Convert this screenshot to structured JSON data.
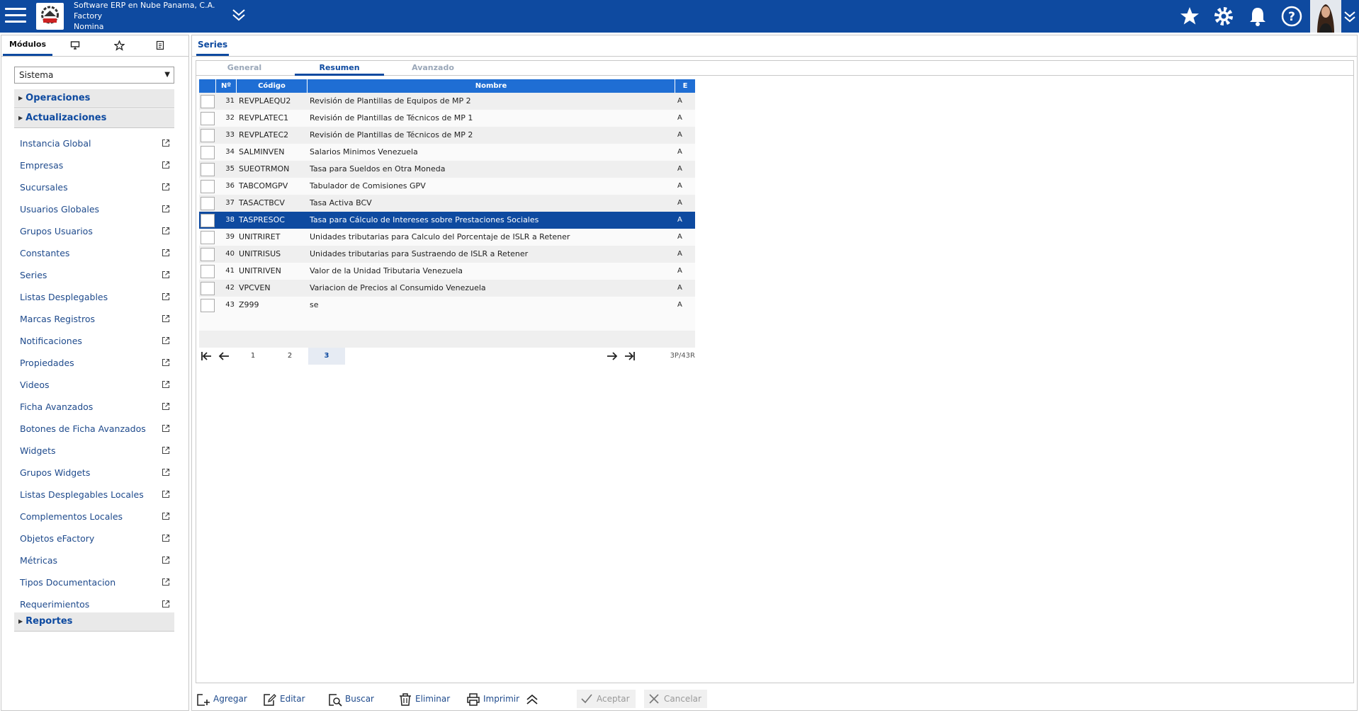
{
  "header": {
    "company_line1": "Software ERP en Nube Panama, C.A.",
    "company_line2": "Factory",
    "company_line3": "Nomina"
  },
  "left_tabs": [
    {
      "label": "Módulos",
      "icon": null
    },
    {
      "label": "",
      "icon": "monitor-icon"
    },
    {
      "label": "",
      "icon": "star-icon"
    },
    {
      "label": "",
      "icon": "pages-icon"
    }
  ],
  "module_select": {
    "value": "Sistema"
  },
  "groups": {
    "operaciones": "Operaciones",
    "actualizaciones": "Actualizaciones",
    "reportes": "Reportes"
  },
  "nav_items": [
    "Instancia Global",
    "Empresas",
    "Sucursales",
    "Usuarios Globales",
    "Grupos Usuarios",
    "Constantes",
    "Series",
    "Listas Desplegables",
    "Marcas Registros",
    "Notificaciones",
    "Propiedades",
    "Videos",
    "Ficha Avanzados",
    "Botones de Ficha Avanzados",
    "Widgets",
    "Grupos Widgets",
    "Listas Desplegables Locales",
    "Complementos Locales",
    "Objetos eFactory",
    "Métricas",
    "Tipos Documentacion",
    "Requerimientos"
  ],
  "main": {
    "tab": "Series",
    "subtabs": [
      "General",
      "Resumen",
      "Avanzado"
    ],
    "active_subtab": "Resumen"
  },
  "grid": {
    "headers": {
      "num": "Nº",
      "code": "Código",
      "name": "Nombre",
      "e": "E"
    },
    "rows": [
      {
        "num": "31",
        "code": "REVPLAEQU2",
        "name": "Revisión de Plantillas de Equipos de MP 2",
        "e": "A"
      },
      {
        "num": "32",
        "code": "REVPLATEC1",
        "name": "Revisión de Plantillas de Técnicos de MP 1",
        "e": "A"
      },
      {
        "num": "33",
        "code": "REVPLATEC2",
        "name": "Revisión de Plantillas de Técnicos de MP 2",
        "e": "A"
      },
      {
        "num": "34",
        "code": "SALMINVEN",
        "name": "Salarios Minimos Venezuela",
        "e": "A"
      },
      {
        "num": "35",
        "code": "SUEOTRMON",
        "name": "Tasa para Sueldos en Otra Moneda",
        "e": "A"
      },
      {
        "num": "36",
        "code": "TABCOMGPV",
        "name": "Tabulador de Comisiones GPV",
        "e": "A"
      },
      {
        "num": "37",
        "code": "TASACTBCV",
        "name": "Tasa Activa BCV",
        "e": "A"
      },
      {
        "num": "38",
        "code": "TASPRESOC",
        "name": "Tasa para Cálculo de Intereses sobre Prestaciones Sociales",
        "e": "A"
      },
      {
        "num": "39",
        "code": "UNITRIRET",
        "name": "Unidades tributarias para Calculo del Porcentaje de ISLR a Retener",
        "e": "A"
      },
      {
        "num": "40",
        "code": "UNITRISUS",
        "name": "Unidades tributarias para Sustraendo de ISLR a Retener",
        "e": "A"
      },
      {
        "num": "41",
        "code": "UNITRIVEN",
        "name": "Valor de la Unidad Tributaria Venezuela",
        "e": "A"
      },
      {
        "num": "42",
        "code": "VPCVEN",
        "name": "Variacion de Precios al Consumido Venezuela",
        "e": "A"
      },
      {
        "num": "43",
        "code": "Z999",
        "name": "se",
        "e": "A"
      }
    ],
    "selected_num": "38",
    "pages": [
      "1",
      "2",
      "3"
    ],
    "current_page": "3",
    "count": "3P/43R"
  },
  "toolbar": {
    "add": "Agregar",
    "edit": "Editar",
    "search": "Buscar",
    "delete": "Eliminar",
    "print": "Imprimir",
    "accept": "Aceptar",
    "cancel": "Cancelar"
  },
  "colors": {
    "brand": "#0e4aa0",
    "grid_header": "#1f6ed4",
    "selected_row": "#0e4aa0"
  }
}
